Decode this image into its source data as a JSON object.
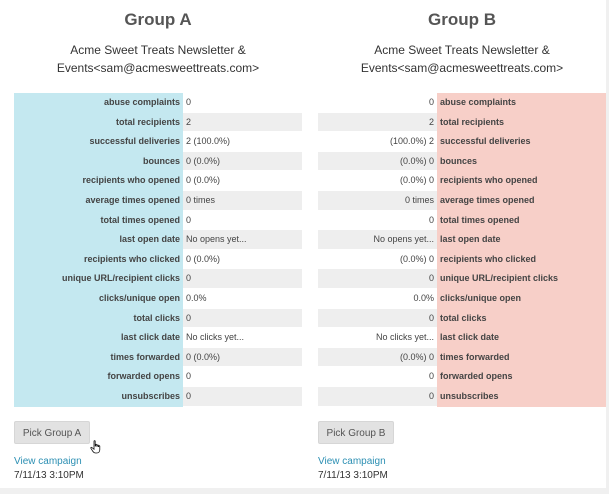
{
  "groups": [
    {
      "title": "Group A",
      "from_line1": "Acme Sweet Treats Newsletter &",
      "from_line2": "Events<sam@acmesweettreats.com>",
      "pick_label": "Pick Group A",
      "view_label": "View campaign",
      "date": "7/11/13 3:10PM",
      "label_color": "#c4e8f0"
    },
    {
      "title": "Group B",
      "from_line1": "Acme Sweet Treats Newsletter &",
      "from_line2": "Events<sam@acmesweettreats.com>",
      "pick_label": "Pick Group B",
      "view_label": "View campaign",
      "date": "7/11/13 3:10PM",
      "label_color": "#f7cfc8"
    }
  ],
  "stats": [
    {
      "label": "abuse complaints",
      "a": "0",
      "b": "0"
    },
    {
      "label": "total recipients",
      "a": "2",
      "b": "2"
    },
    {
      "label": "successful deliveries",
      "a": "2 (100.0%)",
      "b": "(100.0%) 2"
    },
    {
      "label": "bounces",
      "a": "0 (0.0%)",
      "b": "(0.0%) 0"
    },
    {
      "label": "recipients who opened",
      "a": "0 (0.0%)",
      "b": "(0.0%) 0"
    },
    {
      "label": "average times opened",
      "a": "0 times",
      "b": "0 times"
    },
    {
      "label": "total times opened",
      "a": "0",
      "b": "0"
    },
    {
      "label": "last open date",
      "a": "No opens yet...",
      "b": "No opens yet..."
    },
    {
      "label": "recipients who clicked",
      "a": "0 (0.0%)",
      "b": "(0.0%) 0"
    },
    {
      "label": "unique URL/recipient clicks",
      "a": "0",
      "b": "0"
    },
    {
      "label": "clicks/unique open",
      "a": "0.0%",
      "b": "0.0%"
    },
    {
      "label": "total clicks",
      "a": "0",
      "b": "0"
    },
    {
      "label": "last click date",
      "a": "No clicks yet...",
      "b": "No clicks yet..."
    },
    {
      "label": "times forwarded",
      "a": "0 (0.0%)",
      "b": "(0.0%) 0"
    },
    {
      "label": "forwarded opens",
      "a": "0",
      "b": "0"
    },
    {
      "label": "unsubscribes",
      "a": "0",
      "b": "0"
    }
  ]
}
